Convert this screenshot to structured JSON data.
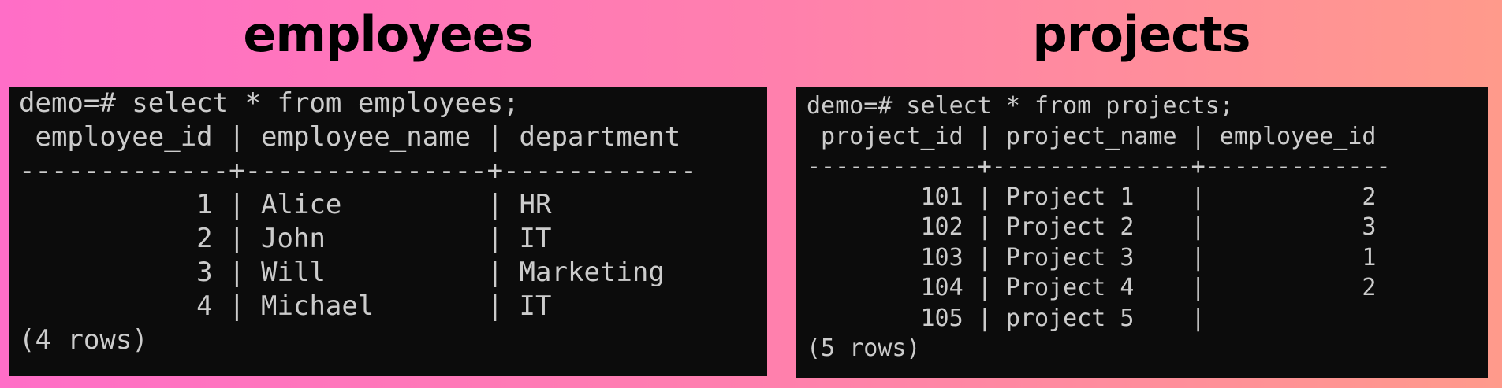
{
  "titles": {
    "employees": "employees",
    "projects": "projects"
  },
  "employees_terminal": {
    "command": "demo=# select * from employees;",
    "header": " employee_id | employee_name | department",
    "separator": "-------------+---------------+------------",
    "rows": [
      "           1 | Alice         | HR",
      "           2 | John          | IT",
      "           3 | Will          | Marketing",
      "           4 | Michael       | IT"
    ],
    "footer": "(4 rows)"
  },
  "projects_terminal": {
    "command": "demo=# select * from projects;",
    "header": " project_id | project_name | employee_id",
    "separator": "------------+--------------+-------------",
    "rows": [
      "        101 | Project 1    |           2",
      "        102 | Project 2    |           3",
      "        103 | Project 3    |           1",
      "        104 | Project 4    |           2",
      "        105 | project 5    |"
    ],
    "footer": "(5 rows)"
  },
  "colors": {
    "terminal_background": "#0c0c0c",
    "terminal_text": "#cccccc",
    "title_text": "#000000",
    "gradient_left": "#ff6ec7",
    "gradient_right": "#ff9a8b"
  }
}
